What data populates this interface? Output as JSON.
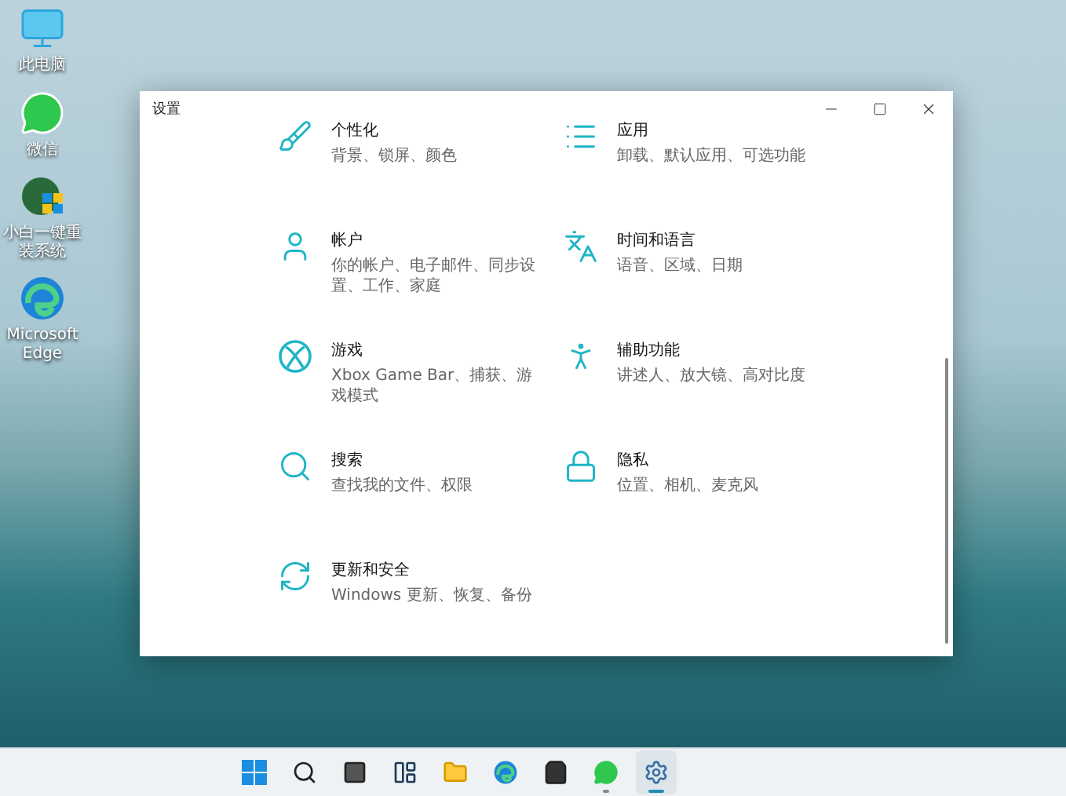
{
  "desktop_icons": [
    {
      "kind": "monitor",
      "label": "此电脑"
    },
    {
      "kind": "chat",
      "label": "微信"
    },
    {
      "kind": "installer",
      "label": "小白一键重装系统"
    },
    {
      "kind": "browser",
      "label": "Microsoft Edge"
    }
  ],
  "window": {
    "title": "设置"
  },
  "settings": [
    {
      "kind": "brush",
      "title": "个性化",
      "description": "背景、锁屏、颜色"
    },
    {
      "kind": "apps",
      "title": "应用",
      "description": "卸载、默认应用、可选功能"
    },
    {
      "kind": "account",
      "title": "帐户",
      "description": "你的帐户、电子邮件、同步设置、工作、家庭"
    },
    {
      "kind": "language",
      "title": "时间和语言",
      "description": "语音、区域、日期"
    },
    {
      "kind": "xbox",
      "title": "游戏",
      "description": "Xbox Game Bar、捕获、游戏模式"
    },
    {
      "kind": "accessibility",
      "title": "辅助功能",
      "description": "讲述人、放大镜、高对比度"
    },
    {
      "kind": "search",
      "title": "搜索",
      "description": "查找我的文件、权限"
    },
    {
      "kind": "privacy",
      "title": "隐私",
      "description": "位置、相机、麦克风"
    },
    {
      "kind": "update",
      "title": "更新和安全",
      "description": "Windows 更新、恢复、备份"
    }
  ],
  "taskbar": [
    {
      "kind": "start",
      "running": false,
      "selected": false
    },
    {
      "kind": "search",
      "running": false,
      "selected": false
    },
    {
      "kind": "taskview",
      "running": false,
      "selected": false
    },
    {
      "kind": "widgets",
      "running": false,
      "selected": false
    },
    {
      "kind": "folder",
      "running": false,
      "selected": false
    },
    {
      "kind": "browser",
      "running": false,
      "selected": false
    },
    {
      "kind": "store",
      "running": false,
      "selected": false
    },
    {
      "kind": "chat",
      "running": true,
      "selected": false
    },
    {
      "kind": "settings",
      "running": true,
      "selected": true
    }
  ]
}
